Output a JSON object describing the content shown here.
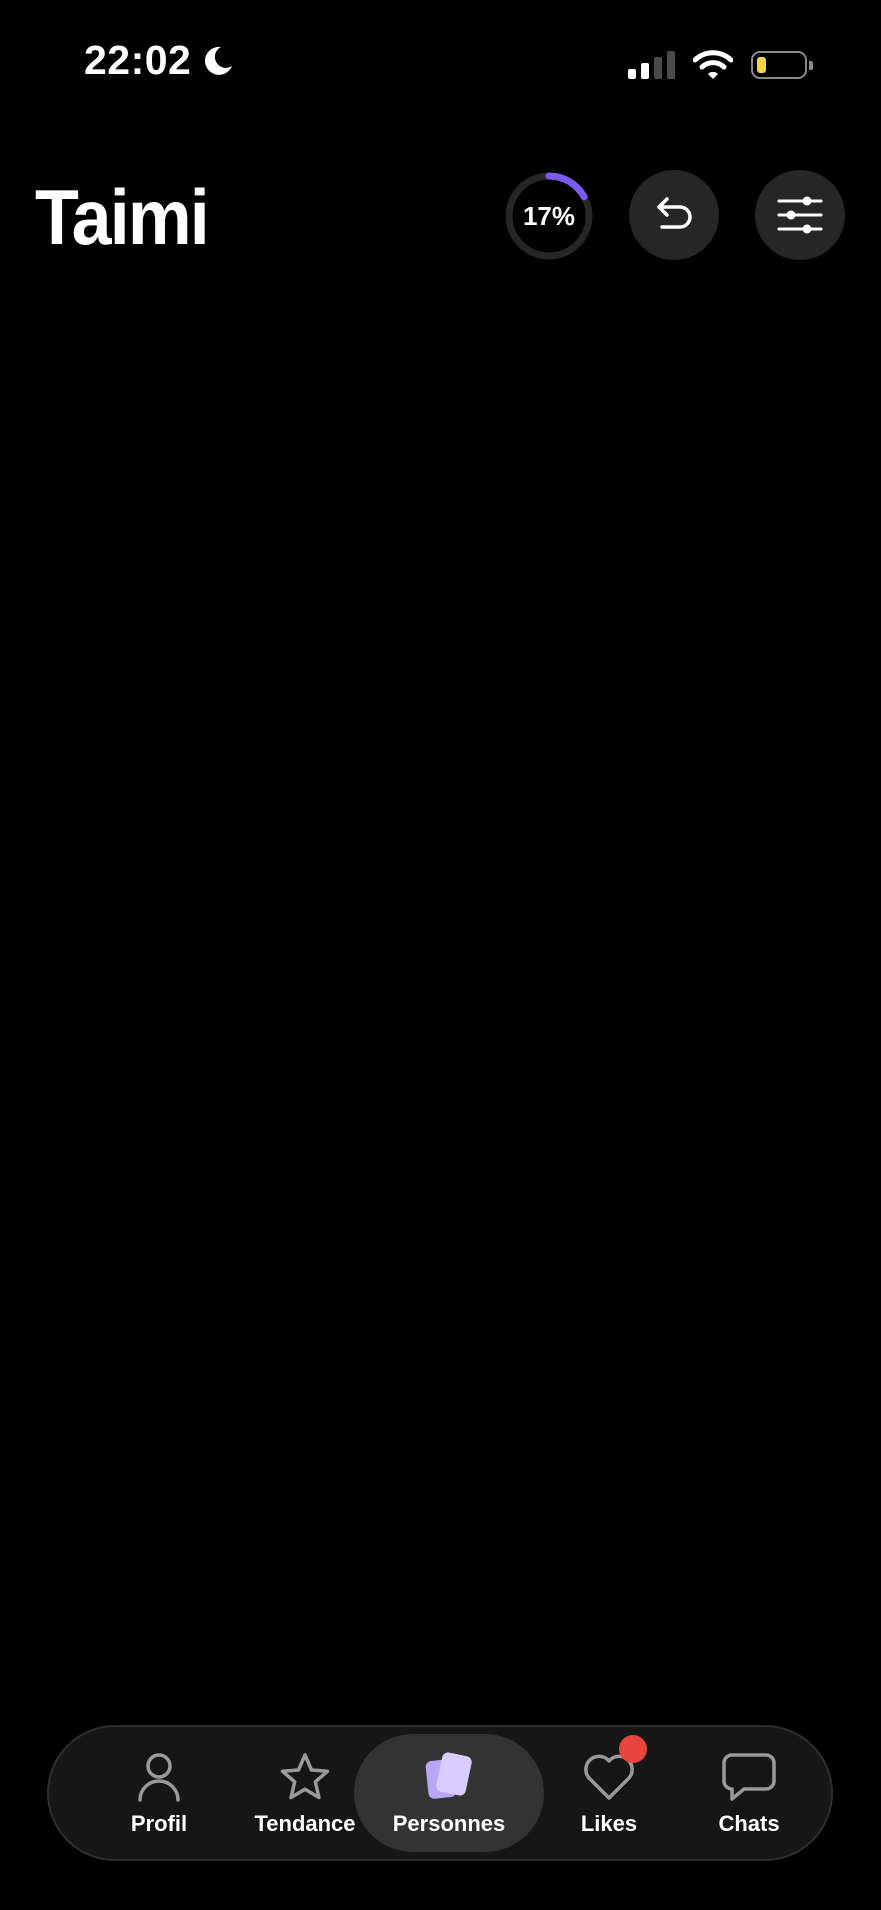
{
  "status_bar": {
    "time": "22:02",
    "icons": [
      "moon-icon",
      "signal-icon",
      "wifi-icon",
      "battery-icon"
    ],
    "battery_color": "#f6d442"
  },
  "header": {
    "logo": "Taimi",
    "progress": {
      "label": "17%",
      "value": 0.17,
      "color": "#7b5cf0"
    },
    "undo_icon": "undo-icon",
    "filter_icon": "sliders-icon"
  },
  "bottom_nav": {
    "items": [
      {
        "label": "Profil",
        "icon": "person-icon",
        "active": false
      },
      {
        "label": "Tendance",
        "icon": "star-icon",
        "active": false
      },
      {
        "label": "Personnes",
        "icon": "cards-icon",
        "active": true
      },
      {
        "label": "Likes",
        "icon": "heart-icon",
        "active": false,
        "notification": true
      },
      {
        "label": "Chats",
        "icon": "chat-bubble-icon",
        "active": false
      }
    ],
    "active_color": "#d9ccff",
    "badge_color": "#e8453c"
  }
}
